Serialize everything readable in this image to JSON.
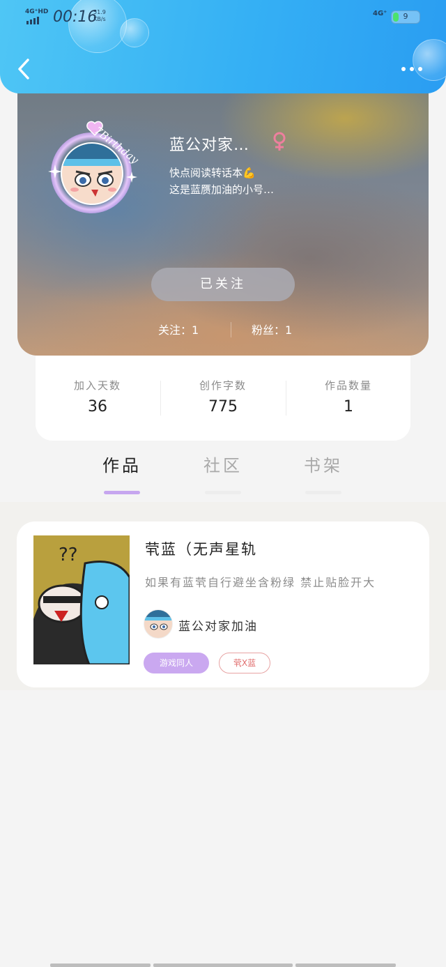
{
  "status_bar": {
    "network_left": "4G⁺HD",
    "time": "00:16",
    "speed_value": "51.9",
    "speed_unit": "KB/s",
    "network_right": "4G⁺",
    "battery": "9",
    "battery_level": 0.09
  },
  "header": {
    "back_icon": "chevron-left-icon",
    "more_icon": "more-horizontal-icon",
    "accent_color": "#35b0f4"
  },
  "profile": {
    "avatar_badge": "7Birthday",
    "nickname": "蓝公对家…",
    "gender_icon": "female-icon",
    "bio_line1": "快点阅读转话本",
    "bio_emoji": "💪",
    "bio_line2": "这是蓝赝加油的小号…",
    "follow_button": "已关注",
    "following": "关注：1",
    "followers": "粉丝：1"
  },
  "stats": [
    {
      "label": "加入天数",
      "value": "36"
    },
    {
      "label": "创作字数",
      "value": "775"
    },
    {
      "label": "作品数量",
      "value": "1"
    }
  ],
  "tabs": [
    {
      "label": "作品",
      "active": true
    },
    {
      "label": "社区",
      "active": false
    },
    {
      "label": "书架",
      "active": false
    }
  ],
  "works": [
    {
      "title": "茕蓝（无声星轨",
      "description": "如果有蓝茕自行避坐含粉绿 禁止贴脸开大",
      "author": "蓝公对家加油",
      "tags": [
        "游戏同人",
        "茕X蓝"
      ]
    }
  ]
}
